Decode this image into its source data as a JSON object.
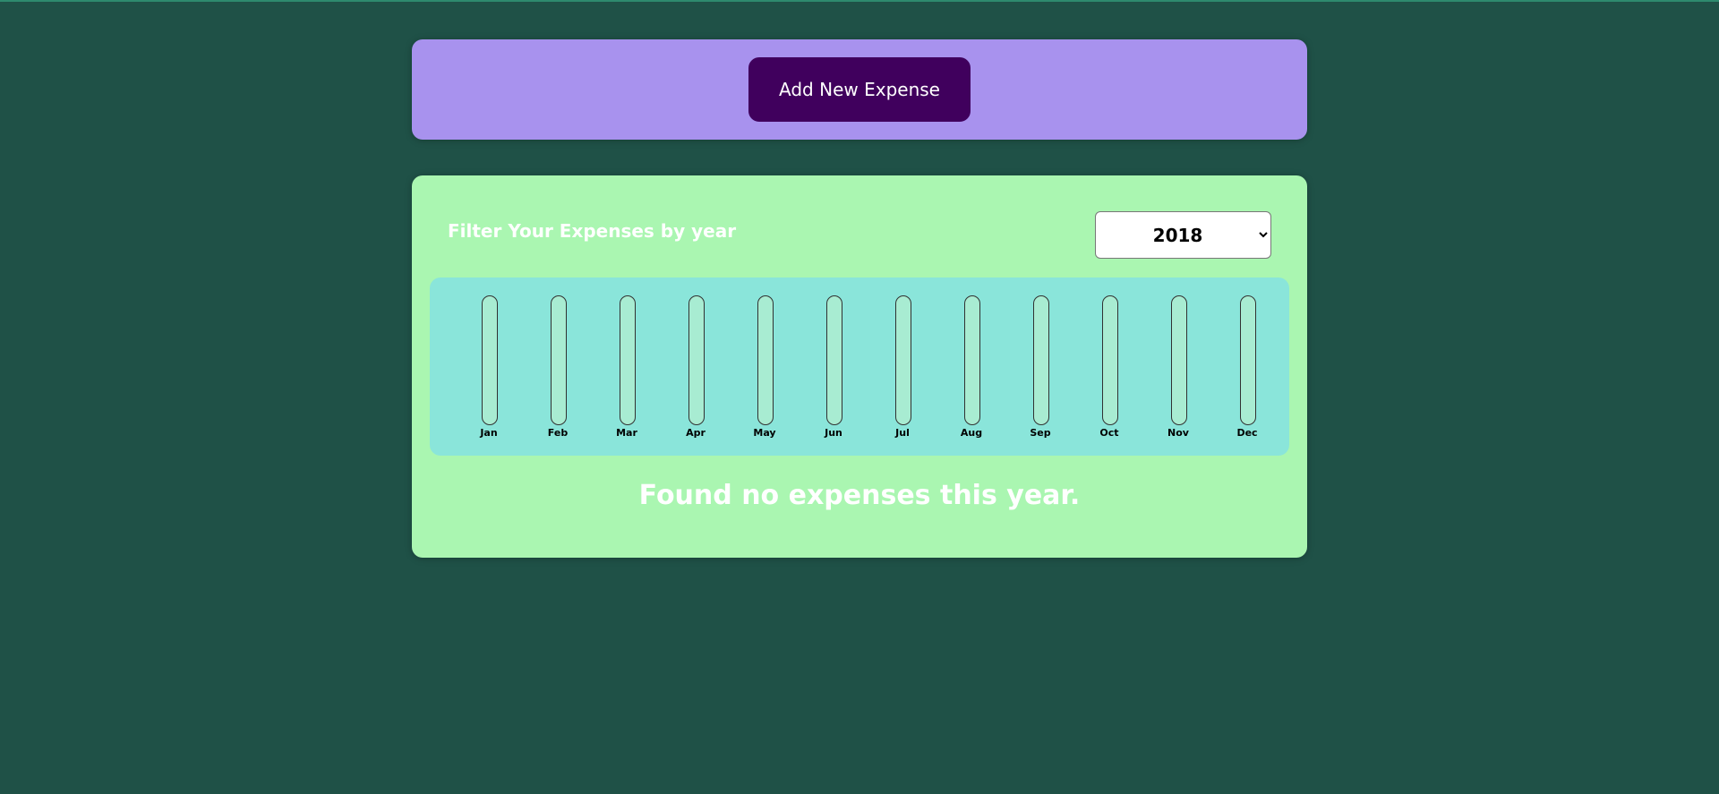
{
  "new_expense": {
    "add_button_label": "Add New Expense"
  },
  "filter": {
    "label": "Filter Your Expenses by year",
    "selected_year": "2018",
    "year_options": [
      "2018"
    ]
  },
  "chart_data": {
    "type": "bar",
    "categories": [
      "Jan",
      "Feb",
      "Mar",
      "Apr",
      "May",
      "Jun",
      "Jul",
      "Aug",
      "Sep",
      "Oct",
      "Nov",
      "Dec"
    ],
    "values": [
      0,
      0,
      0,
      0,
      0,
      0,
      0,
      0,
      0,
      0,
      0,
      0
    ]
  },
  "expenses": {
    "empty_message": "Found no expenses this year."
  },
  "colors": {
    "page_background": "#1f5147",
    "new_expense_panel": "#a892ee",
    "add_button": "#40005d",
    "expenses_panel": "#aaf6b1",
    "chart_background": "#8ae5da",
    "bar_track": "#a8ecd2",
    "bar_fill": "#4826b9"
  }
}
